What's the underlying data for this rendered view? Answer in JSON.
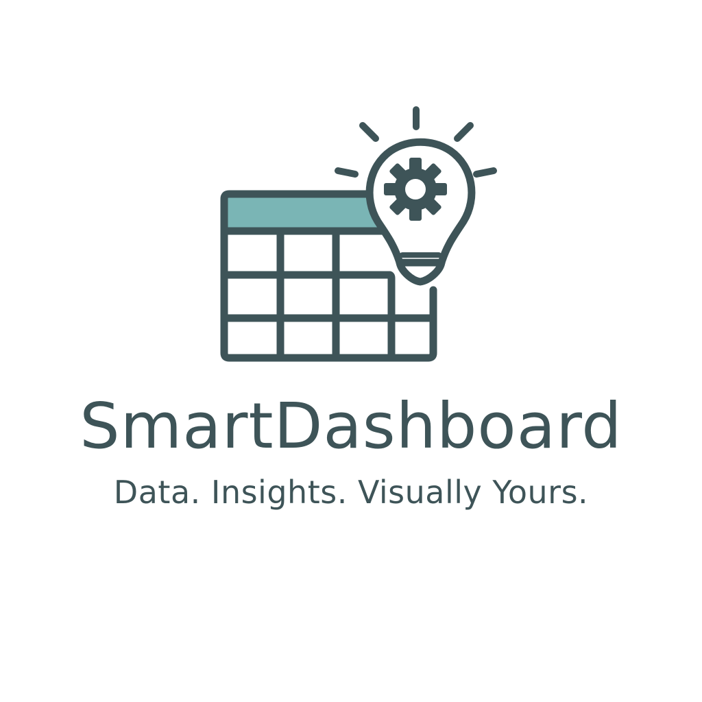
{
  "brand": {
    "name": "SmartDashboard",
    "tagline": "Data. Insights. Visually Yours."
  },
  "icons": {
    "spreadsheet": "spreadsheet-icon",
    "lightbulb": "lightbulb-icon",
    "gear": "gear-icon"
  },
  "colors": {
    "primary": "#3e5458",
    "accent": "#7ab5b5",
    "background": "#ffffff"
  }
}
